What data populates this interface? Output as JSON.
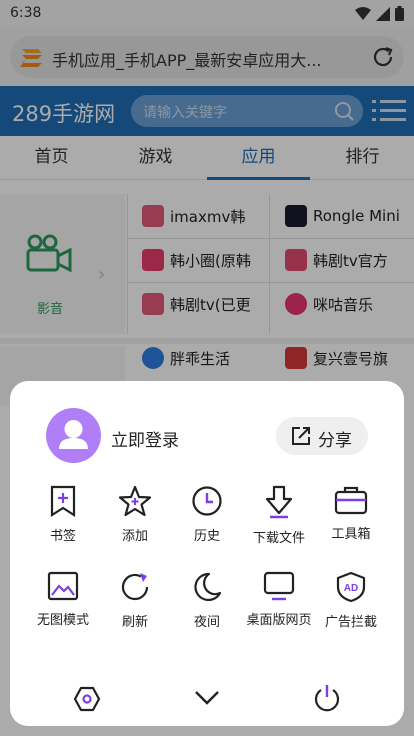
{
  "status": {
    "time": "6:38"
  },
  "browser": {
    "page_title": "手机应用_手机APP_最新安卓应用大..."
  },
  "site": {
    "brand": "289手游网",
    "search_placeholder": "请输入关键字"
  },
  "tabs": [
    {
      "label": "首页"
    },
    {
      "label": "游戏"
    },
    {
      "label": "应用"
    },
    {
      "label": "排行"
    }
  ],
  "category": {
    "label": "影音"
  },
  "apps": [
    {
      "name": "imaxmv韩",
      "color": "#e35a7a"
    },
    {
      "name": "Rongle Mini",
      "color": "#1a1a2e"
    },
    {
      "name": "韩小圈(原韩",
      "color": "#e83d6a"
    },
    {
      "name": "韩剧tv官方",
      "color": "#e04b6e"
    },
    {
      "name": "韩剧tv(已更",
      "color": "#e35a7a"
    },
    {
      "name": "咪咕音乐",
      "color": "#e8336d"
    },
    {
      "name": "胖乖生活",
      "color": "#2f7de1"
    },
    {
      "name": "复兴壹号旗",
      "color": "#d63a3a"
    }
  ],
  "menu": {
    "login_label": "立即登录",
    "share_label": "分享",
    "items_row1": [
      {
        "label": "书签",
        "icon": "bookmark-icon"
      },
      {
        "label": "添加",
        "icon": "star-icon"
      },
      {
        "label": "历史",
        "icon": "clock-icon"
      },
      {
        "label": "下载文件",
        "icon": "download-icon"
      },
      {
        "label": "工具箱",
        "icon": "toolbox-icon"
      }
    ],
    "items_row2": [
      {
        "label": "无图模式",
        "icon": "image-icon"
      },
      {
        "label": "刷新",
        "icon": "refresh-icon"
      },
      {
        "label": "夜间",
        "icon": "moon-icon"
      },
      {
        "label": "桌面版网页",
        "icon": "monitor-icon"
      },
      {
        "label": "广告拦截",
        "icon": "ad-shield-icon"
      }
    ],
    "accent": "#7b3fe4"
  }
}
